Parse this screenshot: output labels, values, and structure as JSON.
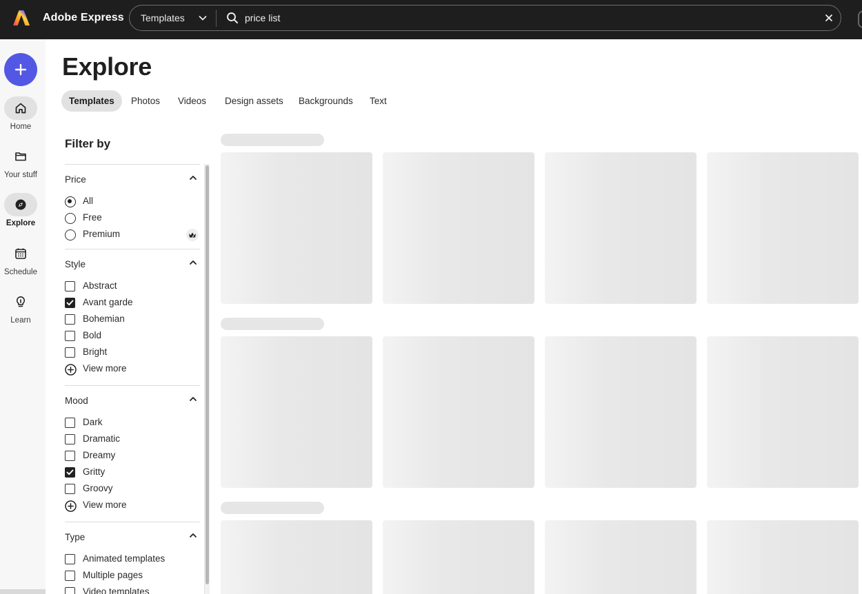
{
  "header": {
    "app_title": "Adobe Express",
    "search_scope": "Templates",
    "search_value": "price list",
    "colors": {
      "background": "#1e1e1e",
      "accent": "#5258e4"
    }
  },
  "rail": {
    "create_icon": "plus-icon",
    "items": [
      {
        "label": "Home",
        "icon": "home-icon"
      },
      {
        "label": "Your stuff",
        "icon": "folder-icon"
      },
      {
        "label": "Explore",
        "icon": "explore-icon",
        "active": true
      },
      {
        "label": "Schedule",
        "icon": "calendar-icon"
      },
      {
        "label": "Learn",
        "icon": "lightbulb-icon"
      }
    ]
  },
  "main": {
    "title": "Explore",
    "tabs": [
      {
        "label": "Templates",
        "active": true
      },
      {
        "label": "Photos"
      },
      {
        "label": "Videos"
      },
      {
        "label": "Design assets"
      },
      {
        "label": "Backgrounds"
      },
      {
        "label": "Text"
      }
    ]
  },
  "filters": {
    "title": "Filter by",
    "sections": [
      {
        "title": "Price",
        "kind": "radio",
        "options": [
          {
            "label": "All",
            "checked": true
          },
          {
            "label": "Free",
            "checked": false
          },
          {
            "label": "Premium",
            "checked": false,
            "badge": "premium-crown-icon"
          }
        ]
      },
      {
        "title": "Style",
        "kind": "checkbox",
        "options": [
          {
            "label": "Abstract",
            "checked": false
          },
          {
            "label": "Avant garde",
            "checked": true
          },
          {
            "label": "Bohemian",
            "checked": false
          },
          {
            "label": "Bold",
            "checked": false
          },
          {
            "label": "Bright",
            "checked": false
          }
        ],
        "more": "View more"
      },
      {
        "title": "Mood",
        "kind": "checkbox",
        "options": [
          {
            "label": "Dark",
            "checked": false
          },
          {
            "label": "Dramatic",
            "checked": false
          },
          {
            "label": "Dreamy",
            "checked": false
          },
          {
            "label": "Gritty",
            "checked": true
          },
          {
            "label": "Groovy",
            "checked": false
          }
        ],
        "more": "View more"
      },
      {
        "title": "Type",
        "kind": "checkbox",
        "options": [
          {
            "label": "Animated templates",
            "checked": false
          },
          {
            "label": "Multiple pages",
            "checked": false
          },
          {
            "label": "Video templates",
            "checked": false
          }
        ]
      }
    ]
  }
}
